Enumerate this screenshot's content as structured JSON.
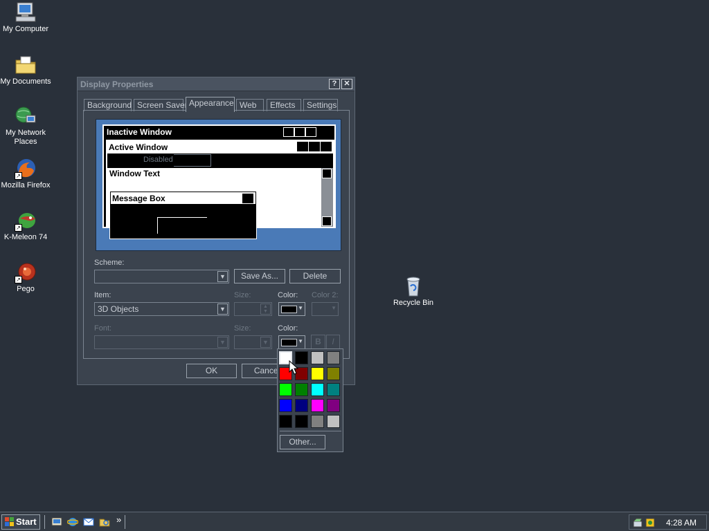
{
  "desktop": {
    "icons": [
      {
        "label": "My Computer",
        "icon": "computer-icon"
      },
      {
        "label": "My Documents",
        "icon": "folder-documents-icon"
      },
      {
        "label": "My Network Places",
        "icon": "network-places-icon"
      },
      {
        "label": "Mozilla Firefox",
        "icon": "firefox-icon"
      },
      {
        "label": "K-Meleon 74",
        "icon": "k-meleon-icon"
      },
      {
        "label": "Pego",
        "icon": "pego-icon"
      },
      {
        "label": "Recycle Bin",
        "icon": "recycle-bin-icon"
      }
    ]
  },
  "dialog": {
    "title": "Display Properties",
    "help_button": "?",
    "close_button": "✕",
    "tabs": [
      "Background",
      "Screen Saver",
      "Appearance",
      "Web",
      "Effects",
      "Settings"
    ],
    "active_tab": "Appearance",
    "preview": {
      "inactive_window": "Inactive Window",
      "active_window": "Active Window",
      "disabled": "Disabled",
      "window_text": "Window Text",
      "message_box": "Message Box"
    },
    "scheme": {
      "label": "Scheme:",
      "value": ""
    },
    "save_as_button": "Save As...",
    "delete_button": "Delete",
    "item": {
      "label": "Item:",
      "value": "3D Objects"
    },
    "size_label": "Size:",
    "color_label": "Color:",
    "color2_label": "Color 2:",
    "font": {
      "label": "Font:",
      "value": ""
    },
    "font_size_label": "Size:",
    "font_color_label": "Color:",
    "bold_button": "B",
    "italic_button": "I",
    "ok_button": "OK",
    "cancel_button": "Cancel"
  },
  "color_popup": {
    "colors": [
      "#ffffff",
      "#000000",
      "#c0c0c0",
      "#808080",
      "#ff0000",
      "#800000",
      "#ffff00",
      "#808000",
      "#00ff00",
      "#008000",
      "#00ffff",
      "#008080",
      "#0000ff",
      "#000080",
      "#ff00ff",
      "#800080",
      "#000000",
      "#000000",
      "#808080",
      "#c0c0c0"
    ],
    "selected_index": 0,
    "other_button": "Other..."
  },
  "taskbar": {
    "start_label": "Start",
    "quick_launch": [
      "desktop-icon",
      "ie-icon",
      "outlook-icon",
      "explorer-icon"
    ],
    "overflow": "»",
    "clock": "4:28 AM"
  }
}
